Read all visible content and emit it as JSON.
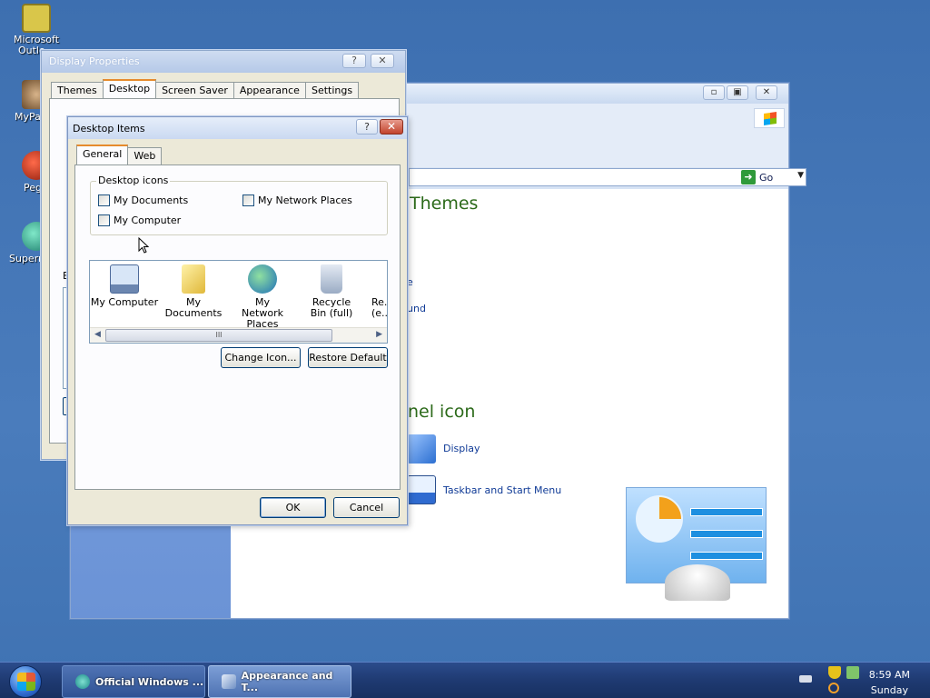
{
  "desktop": {
    "icons": [
      {
        "label": "Microsoft Outlo..."
      },
      {
        "label": "MyPa..."
      },
      {
        "label": "Peg..."
      },
      {
        "label": "Superm..."
      }
    ]
  },
  "control_panel": {
    "go_label": "Go",
    "headings": {
      "themes": "Themes",
      "panel_icon": "nel icon"
    },
    "links": {
      "partial_e": "e",
      "partial_und": "und",
      "display": "Display",
      "taskbar": "Taskbar and Start Menu"
    }
  },
  "display_properties": {
    "title": "Display Properties",
    "tabs": [
      "Themes",
      "Desktop",
      "Screen Saver",
      "Appearance",
      "Settings"
    ],
    "selected_tab": "Desktop",
    "partial_label": "B"
  },
  "desktop_items": {
    "title": "Desktop Items",
    "tabs": [
      "General",
      "Web"
    ],
    "selected_tab": "General",
    "group_label": "Desktop icons",
    "checkboxes": [
      {
        "label": "My Documents",
        "checked": false
      },
      {
        "label": "My Network Places",
        "checked": false
      },
      {
        "label": "My Computer",
        "checked": false
      }
    ],
    "icon_list": [
      {
        "label": "My Computer"
      },
      {
        "label": "My Documents"
      },
      {
        "label": "My Network Places"
      },
      {
        "label": "Recycle Bin (full)"
      },
      {
        "label": "Re... (e..."
      }
    ],
    "scroll_grip": "III",
    "buttons": {
      "change_icon": "Change Icon...",
      "restore_default": "Restore Default",
      "ok": "OK",
      "cancel": "Cancel"
    }
  },
  "taskbar": {
    "tasks": [
      {
        "label": "Official Windows ..."
      },
      {
        "label": "Appearance and T..."
      }
    ],
    "clock": {
      "time": "8:59 AM",
      "day": "Sunday"
    }
  },
  "colors": {
    "desktop": "#3d6fb0",
    "heading_green": "#2c6a1a",
    "link_blue": "#0f3a96",
    "tab_highlight": "#e68b2c"
  }
}
